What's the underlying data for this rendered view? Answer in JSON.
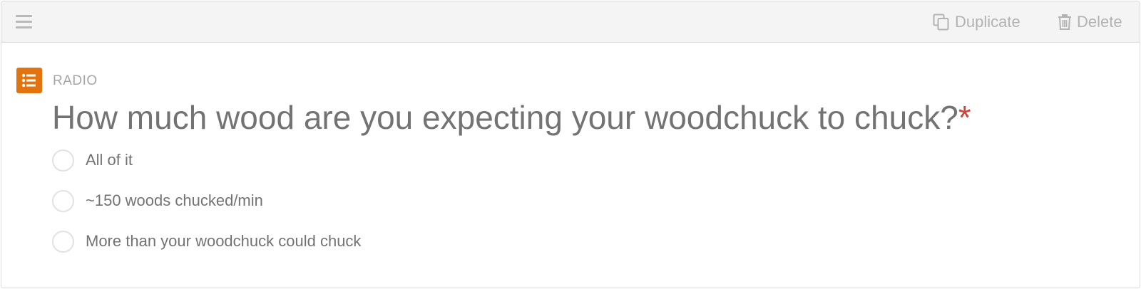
{
  "toolbar": {
    "drag_icon": "hamburger-menu-icon",
    "duplicate_icon": "copy-icon",
    "duplicate_label": "Duplicate",
    "delete_icon": "trash-icon",
    "delete_label": "Delete"
  },
  "field": {
    "type_icon": "list-icon",
    "type_label": "RADIO",
    "accent_color": "#e1740f",
    "question": "How much wood are you expecting your woodchuck to chuck?",
    "required_marker": "*",
    "required_color": "#d0413a",
    "options": [
      {
        "label": "All of it",
        "selected": false
      },
      {
        "label": "~150 woods chucked/min",
        "selected": false
      },
      {
        "label": "More than your woodchuck could chuck",
        "selected": false
      }
    ]
  }
}
